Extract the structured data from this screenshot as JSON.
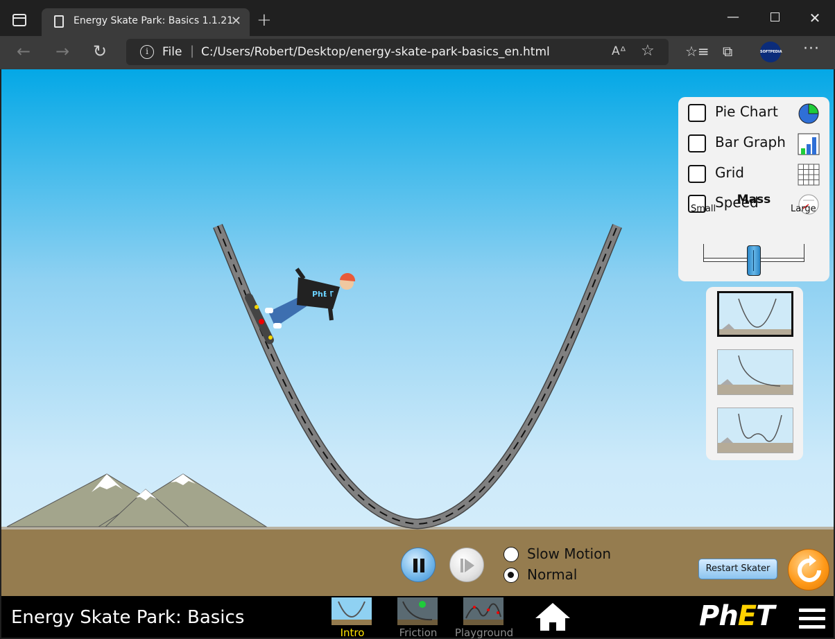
{
  "browser": {
    "tab_title": "Energy Skate Park: Basics 1.1.21",
    "tab_close": "✕",
    "new_tab": "+",
    "address_scheme": "File",
    "address_url": "C:/Users/Robert/Desktop/energy-skate-park-basics_en.html",
    "profile_badge": "SOFTPEDIA",
    "read_aloud": "A",
    "more": "···"
  },
  "controls": {
    "pie_chart": "Pie Chart",
    "bar_graph": "Bar Graph",
    "grid": "Grid",
    "speed": "Speed",
    "mass_title": "Mass",
    "mass_small": "Small",
    "mass_large": "Large",
    "mass_value": 0.5
  },
  "playback": {
    "slow_motion": "Slow Motion",
    "normal": "Normal",
    "selected": "Normal",
    "restart": "Restart Skater"
  },
  "navbar": {
    "title": "Energy Skate Park: Basics",
    "screens": [
      "Intro",
      "Friction",
      "Playground"
    ],
    "active_screen": "Intro",
    "brand": "PhET"
  },
  "colors": {
    "sky_top": "#04a8e6",
    "ground": "#957c4f",
    "track": "#7a7a7a",
    "active_screen": "#ffe400"
  }
}
